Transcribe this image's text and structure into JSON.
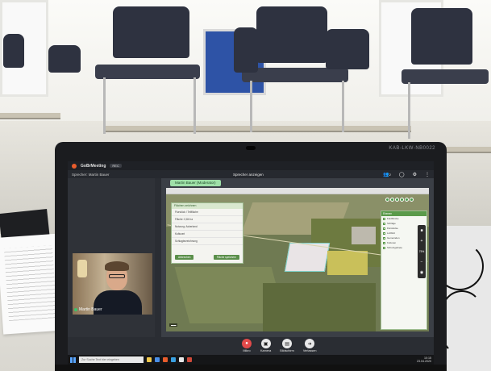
{
  "laptop": {
    "model_label": "KAB-LKW-NB0022"
  },
  "app": {
    "name": "GoBrMeeting",
    "badge": "REC",
    "speaker_left": "Sprecher: Martin Bauer",
    "speaker_center": "Sprecher anzeigen",
    "participant_count": "2"
  },
  "share": {
    "label": "Martin Bauer (Moderator)"
  },
  "dialog": {
    "title": "Flächen zeichnen",
    "rows": [
      "Flurstück / Teilfläche",
      "Fläche: 0,84 ha",
      "Nutzung: Ackerland",
      "Kulturart",
      "Schlagbezeichnung"
    ],
    "cancel": "Abbrechen",
    "save": "Fläche speichern"
  },
  "layers": {
    "title": "Ebenen",
    "items": [
      "Feldblöcke",
      "Schläge",
      "Flurstücke",
      "Luftbild",
      "Gemeinden",
      "Kulturen",
      "Schutzgebiete"
    ]
  },
  "zoom": {
    "level": "75%"
  },
  "participant": {
    "name": "Martin Bauer"
  },
  "controls": [
    {
      "label": "Mikro",
      "icon": "microphone-icon"
    },
    {
      "label": "Kamera",
      "icon": "camera-icon"
    },
    {
      "label": "Bildschirm",
      "icon": "screen-share-icon"
    },
    {
      "label": "Verlassen",
      "icon": "leave-icon"
    }
  ],
  "taskbar": {
    "search_placeholder": "Zur Suche Text hier eingeben",
    "time": "10:15",
    "date": "23.04.2020"
  },
  "colors": {
    "brand_orange": "#e85c2c",
    "share_label_bg": "#9fe0a8",
    "mic_red": "#e24a4a",
    "map_green": "#5a9a4a"
  }
}
